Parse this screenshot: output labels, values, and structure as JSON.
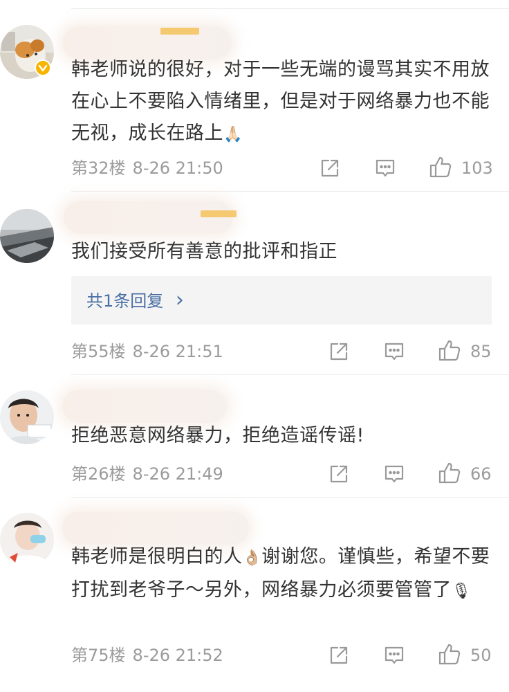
{
  "comments": [
    {
      "text": "韩老师说的很好，对于一些无端的谩骂其实不用放在心上不要陷入情绪里，但是对于网络暴力也不能无视，成长在路上",
      "emoji": "🙏🏻",
      "floor": "第32楼",
      "time": "8-26 21:50",
      "likes": "103",
      "verified": true
    },
    {
      "text": "我们接受所有善意的批评和指正",
      "reply_label": "共1条回复",
      "reply_chevron": "›",
      "floor": "第55楼",
      "time": "8-26 21:51",
      "likes": "85"
    },
    {
      "text": "拒绝恶意网络暴力，拒绝造谣传谣!",
      "floor": "第26楼",
      "time": "8-26 21:49",
      "likes": "66"
    },
    {
      "text_a": "韩老师是很明白的人",
      "emoji_a": "👌🏼",
      "text_b": "谢谢您。谨慎些，希望不要打扰到老爷子～另外，网络暴力必须要管管了",
      "emoji_b": "🎙",
      "floor": "第75楼",
      "time": "8-26 21:52",
      "likes": "50"
    }
  ],
  "icons": {
    "share": "share-icon",
    "comment": "comment-icon",
    "like": "thumbs-up-icon",
    "verified": "verified-badge-icon"
  },
  "colors": {
    "text": "#333333",
    "meta": "#9b9b9b",
    "reply_link": "#4a6fa5",
    "reply_bg": "#f4f4f4",
    "verified": "#f7b500"
  }
}
